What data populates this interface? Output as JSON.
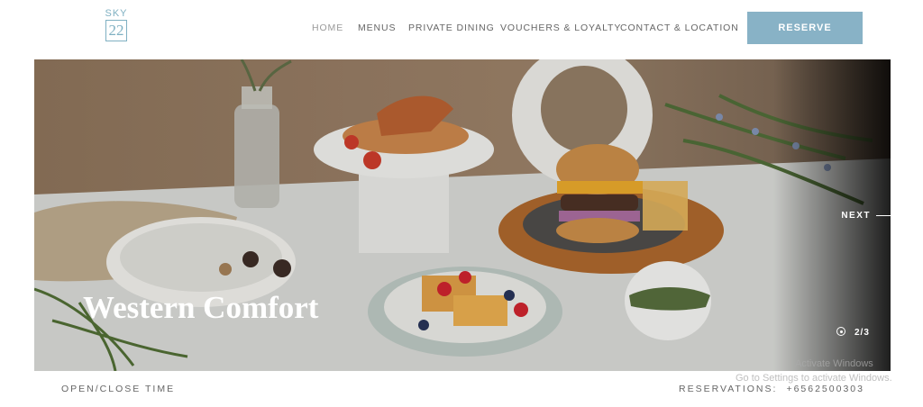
{
  "logo": {
    "line1": "SKY",
    "line2": "22"
  },
  "nav": {
    "items": [
      {
        "label": "HOME",
        "active": true
      },
      {
        "label": "MENUS"
      },
      {
        "label": "PRIVATE DINING"
      },
      {
        "label": "VOUCHERS & LOYALTY"
      },
      {
        "label": "CONTACT & LOCATION"
      }
    ]
  },
  "reserve_button": {
    "label": "RESERVE"
  },
  "hero": {
    "title": "Western Comfort",
    "next_label": "NEXT",
    "counter": "2/3"
  },
  "footer": {
    "open_close": "OPEN/CLOSE TIME",
    "reservations_label": "RESERVATIONS:",
    "phone": "+6562500303"
  },
  "windows_overlay": {
    "line1": "Activate Windows",
    "line2": "Go to Settings to activate Windows."
  },
  "colors": {
    "accent": "#88b2c6",
    "logo": "#7fb0c2"
  }
}
